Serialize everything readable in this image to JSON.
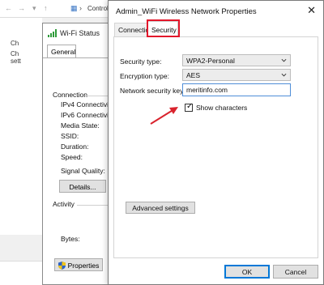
{
  "background_window": {
    "breadcrumb": "Control",
    "left_lines": [
      "Ch",
      "Ch",
      "sett"
    ]
  },
  "wifi_status": {
    "title": "Wi-Fi Status",
    "tab": "General",
    "connection_heading": "Connection",
    "rows": [
      "IPv4 Connectivit",
      "IPv6 Connectivit",
      "Media State:",
      "SSID:",
      "Duration:",
      "Speed:"
    ],
    "signal_quality_label": "Signal Quality:",
    "details_button": "Details...",
    "activity_heading": "Activity",
    "bytes_label": "Bytes:",
    "properties_button": "Properties",
    "shield_icon": "uac-shield-icon"
  },
  "dialog": {
    "title": "Admin_WiFi Wireless Network Properties",
    "close_icon": "close-icon",
    "tabs": [
      {
        "label": "Connection",
        "active": false
      },
      {
        "label": "Security",
        "active": true
      }
    ],
    "highlight_color": "#e3172b",
    "security_type_label": "Security type:",
    "security_type_value": "WPA2-Personal",
    "encryption_type_label": "Encryption type:",
    "encryption_type_value": "AES",
    "network_key_label": "Network security key",
    "network_key_value": "meritinfo.com",
    "show_characters_label": "Show characters",
    "show_characters_checked": true,
    "advanced_button": "Advanced settings",
    "ok_button": "OK",
    "cancel_button": "Cancel",
    "arrow_color": "#d9232d"
  }
}
